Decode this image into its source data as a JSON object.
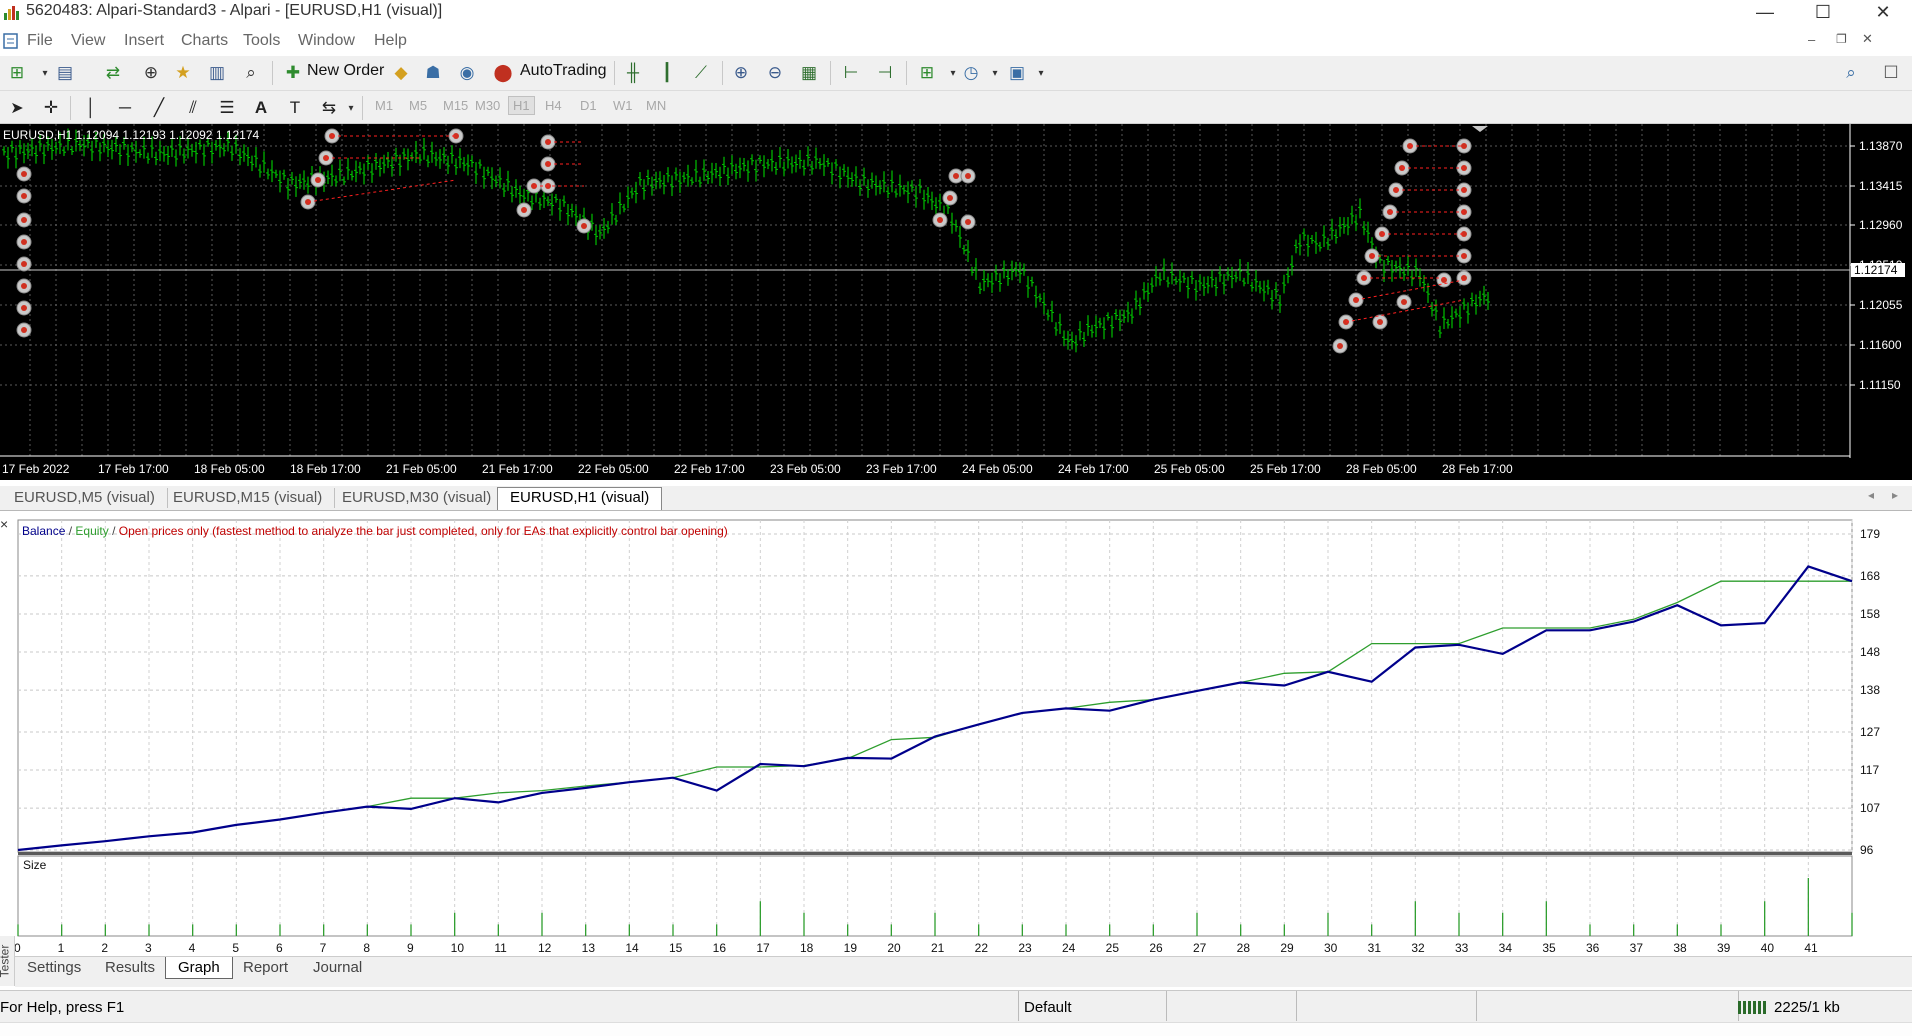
{
  "window": {
    "title": "5620483: Alpari-Standard3 - Alpari - [EURUSD,H1 (visual)]",
    "controls": [
      "—",
      "☐",
      "✕"
    ]
  },
  "menu": [
    "File",
    "View",
    "Insert",
    "Charts",
    "Tools",
    "Window",
    "Help"
  ],
  "toolbar": {
    "new_order": "New Order",
    "autotrading": "AutoTrading",
    "timeframes": [
      "M1",
      "M5",
      "M15",
      "M30",
      "H1",
      "H4",
      "D1",
      "W1",
      "MN"
    ],
    "active_timeframe": "H1"
  },
  "chart": {
    "symbol_info": "EURUSD,H1  1.12094 1.12193 1.12092 1.12174",
    "price_levels": [
      "1.13870",
      "1.13415",
      "1.12960",
      "1.12510",
      "1.12055",
      "1.11600",
      "1.11150"
    ],
    "current_price": "1.12174",
    "time_labels": [
      "17 Feb 2022",
      "17 Feb 17:00",
      "18 Feb 05:00",
      "18 Feb 17:00",
      "21 Feb 05:00",
      "21 Feb 17:00",
      "22 Feb 05:00",
      "22 Feb 17:00",
      "23 Feb 05:00",
      "23 Feb 17:00",
      "24 Feb 05:00",
      "24 Feb 17:00",
      "25 Feb 05:00",
      "25 Feb 17:00",
      "28 Feb 05:00",
      "28 Feb 17:00"
    ],
    "colors": {
      "background": "#000000",
      "candles": "#00c000",
      "grid": "#5a5a5a",
      "trade_lines": "#ff2020"
    }
  },
  "chart_tabs": [
    "EURUSD,M5 (visual)",
    "EURUSD,M15 (visual)",
    "EURUSD,M30 (visual)",
    "EURUSD,H1 (visual)"
  ],
  "active_chart_tab": "EURUSD,H1 (visual)",
  "tester": {
    "legend_balance": "Balance",
    "legend_sep": " / ",
    "legend_equity": "Equity",
    "legend_mode": "Open prices only (fastest method to analyze the bar just completed, only for EAs that explicitly control bar opening)",
    "size_label": "Size",
    "side_label": "Tester",
    "tabs": [
      "Settings",
      "Results",
      "Graph",
      "Report",
      "Journal"
    ],
    "active_tab": "Graph",
    "colors": {
      "balance": "#00008b",
      "equity": "#2e9e2e",
      "mode": "#c00000"
    }
  },
  "chart_data": {
    "type": "line",
    "x": [
      0,
      1,
      2,
      3,
      4,
      5,
      6,
      7,
      8,
      9,
      10,
      11,
      12,
      13,
      14,
      15,
      16,
      17,
      18,
      19,
      20,
      21,
      22,
      23,
      24,
      25,
      26,
      27,
      28,
      29,
      30,
      31,
      32,
      33,
      34,
      35,
      36,
      37,
      38,
      39,
      40,
      41,
      42
    ],
    "x_ticks": [
      0,
      1,
      2,
      3,
      4,
      5,
      6,
      7,
      8,
      9,
      10,
      11,
      12,
      13,
      14,
      15,
      16,
      17,
      18,
      19,
      20,
      21,
      22,
      23,
      24,
      25,
      26,
      27,
      28,
      29,
      30,
      31,
      32,
      33,
      34,
      35,
      36,
      37,
      38,
      39,
      40,
      41
    ],
    "y_ticks": [
      179,
      168,
      158,
      148,
      138,
      127,
      117,
      107,
      96
    ],
    "ylim": [
      96,
      179
    ],
    "series": [
      {
        "name": "Balance",
        "values": [
          96,
          97.2,
          98.3,
          99.6,
          100.6,
          102.6,
          104,
          105.8,
          107.4,
          106.8,
          109.6,
          108.5,
          111,
          112.3,
          113.8,
          115,
          111.6,
          118.6,
          118,
          120.2,
          120,
          125.8,
          129,
          132,
          133.2,
          132.6,
          135.5,
          137.8,
          140,
          139.2,
          142.8,
          140.2,
          149.2,
          149.9,
          147.5,
          153.7,
          153.7,
          156,
          160.3,
          155,
          155.6,
          170.5,
          166.6
        ]
      },
      {
        "name": "Equity",
        "values": [
          96,
          97.2,
          98.3,
          99.6,
          100.6,
          102.6,
          104,
          105.8,
          107.4,
          109.6,
          109.6,
          111,
          111.6,
          112.8,
          113.8,
          115,
          117.8,
          117.8,
          118.2,
          120,
          125,
          125.6,
          129,
          132,
          133.2,
          134.8,
          135.5,
          137.8,
          140,
          142.4,
          142.8,
          150.2,
          150.2,
          150.2,
          154.3,
          154.3,
          154.3,
          156.6,
          161,
          166.6,
          166.6,
          166.6,
          166.6
        ]
      },
      {
        "name": "Size",
        "values": [
          1,
          1,
          1,
          1,
          1,
          1,
          1,
          1,
          1,
          1,
          2,
          1,
          2,
          1,
          1,
          1,
          1,
          3,
          2,
          1,
          1,
          2,
          1,
          1,
          1,
          1,
          1,
          2,
          1,
          1,
          2,
          1,
          3,
          2,
          2,
          3,
          1,
          1,
          1,
          1,
          3,
          5,
          2
        ]
      }
    ]
  },
  "status": {
    "help": "For Help, press F1",
    "profile": "Default",
    "traffic": "2225/1 kb"
  }
}
